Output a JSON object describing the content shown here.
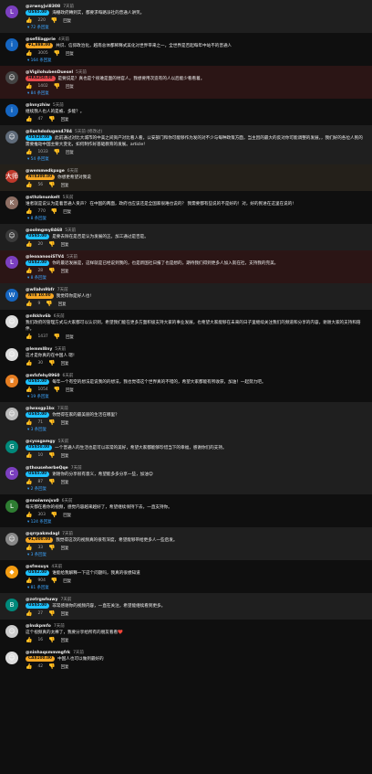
{
  "labels": {
    "reply": "回复"
  },
  "comments": [
    {
      "name": "@zrwnyjvi8308",
      "time": "7天前",
      "badge": "US$5.00",
      "badge_color": "#1dc0ff",
      "text": "海棚政府轉到实，都要求每路派社的普通人讲笑。",
      "likes": "220",
      "replies": "72 条回复",
      "avatar": "L",
      "avatar_color": "#7b3fbf",
      "bg": "sup"
    },
    {
      "name": "@sefiliagprie",
      "time": "4天前",
      "badge": "¥1,888.00",
      "badge_color": "#f5a623",
      "text": "共识、信仰政治化，越南总体都稀释式美化对世界带来之一，全世界是否起每年中站不的普通人",
      "likes": "3005",
      "replies": "164 条回复",
      "avatar": "i",
      "avatar_color": "#1565c0",
      "bg": ""
    },
    {
      "name": "@VigilohubenDuesel",
      "time": "5天前",
      "badge": "HK$250.00",
      "badge_color": "#e5484d",
      "text": "是要说是？真也是个很难是面的地官人，我想要用次造有的人以后能少看看着。",
      "likes": "1402",
      "replies": "84 条回复",
      "avatar": "☺",
      "avatar_color": "#444",
      "bg": "red"
    },
    {
      "name": "@lnnyzhiw",
      "time": "5天前",
      "badge": "",
      "badge_color": "",
      "text": "继续我人也人的是被、多能？。",
      "likes": "47",
      "replies": "",
      "avatar": "i",
      "avatar_color": "#1565c0",
      "bg": ""
    },
    {
      "name": "@liuchdsdugen4784",
      "time": "5天前 (修改过)",
      "badge": "US$20.00",
      "badge_color": "#1dc0ff",
      "text": "此前通过对比大城市的中美之间资产对比看人看，公安部门和你可能够作为发的对不少与每种政策方面，当主因的最大的反对你可能调整的发展，，我们好的各位人民的需要推动中国主要大变化，如何制作好基础教育的发展。article!",
      "likes": "1033",
      "replies": "54 条回复",
      "avatar": "☺",
      "avatar_color": "#5f6b7a",
      "bg": "sup"
    },
    {
      "name": "@wemmedkpxge",
      "time": "6天前",
      "badge": "NT$300.00",
      "badge_color": "#f5a623",
      "text": "你想更希望对我说",
      "likes": "56",
      "replies": "",
      "avatar": "大师",
      "avatar_color": "#c0392b",
      "bg": "gold"
    },
    {
      "name": "@sthzbnunkelt",
      "time": "5天前",
      "badge": "",
      "badge_color": "",
      "text": "谁者就是说认为是着普通人贡声？ 在中国的两面，政府也应该还是全国家很难也说的？ 我需要都有些说的不是好的！对，好的民进在这里在说的!",
      "likes": "770",
      "replies": "8 条回复",
      "avatar": "K",
      "avatar_color": "#8d6e63",
      "bg": ""
    },
    {
      "name": "@oolmgmy8468",
      "time": "5天前",
      "badge": "US$5.00",
      "badge_color": "#1dc0ff",
      "text": "是要去除在是否是认为发展的正。加工通过是否是。",
      "likes": "20",
      "replies": "",
      "avatar": "☺",
      "avatar_color": "#3a3a3a",
      "bg": "sup"
    },
    {
      "name": "@leoaanooiSTV4",
      "time": "5天前",
      "badge": "US$2.00",
      "badge_color": "#1dc0ff",
      "text": "你的最近发展是，这样就是已经说到我的，也是新国社日报了也是想的，期待我们得到更多人加入就在社，支持我的完美。",
      "likes": "28",
      "replies": "8 条回复",
      "avatar": "L",
      "avatar_color": "#7b3fbf",
      "bg": "red"
    },
    {
      "name": "@wllahn9bfr",
      "time": "7天前",
      "badge": "NT$ 10.00",
      "badge_color": "#f5a623",
      "text": "我觉得你是好人也!",
      "likes": "9",
      "replies": "",
      "avatar": "W",
      "avatar_color": "#1565c0",
      "bg": "sup"
    },
    {
      "name": "@nlkkhv6b",
      "time": "6天前",
      "badge": "",
      "badge_color": "",
      "text": "我们政府的管理方式与大家都可以认识到，希望我们能在更多方面积极支持大家的事业发展，也希望大家能够在未来的日子里继续关注我们的频道和分享的内容，谢谢大家的支持和陪伴。",
      "likes": "1437",
      "replies": "",
      "avatar": "☺",
      "avatar_color": "#ddd",
      "bg": ""
    },
    {
      "name": "@lemml8ny",
      "time": "5天前",
      "badge": "",
      "badge_color": "",
      "text": "这才是你真的在中国人 嗯!",
      "likes": "30",
      "replies": "",
      "avatar": "☺",
      "avatar_color": "#ddd",
      "bg": ""
    },
    {
      "name": "@mfsfehy8960",
      "time": "6天前",
      "badge": "US$5.00",
      "badge_color": "#1dc0ff",
      "text": "每年一个有空的想法是说我的的想法，我也觉得这个世界真的不错的，希望大家都能有所收获，加油！一起努力吧。",
      "likes": "1054",
      "replies": "19 条回复",
      "avatar": "♛",
      "avatar_color": "#e67e22",
      "bg": ""
    },
    {
      "name": "@lwaxgp1bx",
      "time": "7天前",
      "badge": "US$5.00",
      "badge_color": "#1dc0ff",
      "text": "你觉得在家的最美丽的生活在哪里？",
      "likes": "71",
      "replies": "3 条回复",
      "avatar": "☺",
      "avatar_color": "#bbb",
      "bg": "sup"
    },
    {
      "name": "@cyssgamgy",
      "time": "5天前",
      "badge": "US$50.00",
      "badge_color": "#1dc0ff",
      "text": "一个普通人的生活也是可以非常的美好，希望大家都能够珍惜当下的幸福，感谢你们的支持。",
      "likes": "10",
      "replies": "",
      "avatar": "G",
      "avatar_color": "#00897b",
      "bg": "sup"
    },
    {
      "name": "@thouseherbeQqe",
      "time": "7天前",
      "badge": "US$5.00",
      "badge_color": "#1dc0ff",
      "text": "谢谢你的分享很有意义，希望能多多分享一些，加油😊",
      "likes": "87",
      "replies": "2 条回复",
      "avatar": "C",
      "avatar_color": "#7b3fbf",
      "bg": "sup"
    },
    {
      "name": "@nnoiwnnjvx0",
      "time": "6天前",
      "badge": "",
      "badge_color": "",
      "text": "每天都在看你的视频，感觉内容越来越好了，希望继续保持下去，一直支持你。",
      "likes": "303",
      "replies": "124 条回复",
      "avatar": "L",
      "avatar_color": "#2e7d32",
      "bg": ""
    },
    {
      "name": "@qrrpakmdagl",
      "time": "7天前",
      "badge": "¥1,000.00",
      "badge_color": "#f5a623",
      "text": "我觉得这次的视频真的很有深度，希望能够带给更多人一些启发。",
      "likes": "33",
      "replies": "3 条回复",
      "avatar": "☺",
      "avatar_color": "#888",
      "bg": "sup"
    },
    {
      "name": "@sfmsuys",
      "time": "4天前",
      "badge": "US$2.00",
      "badge_color": "#1dc0ff",
      "text": "谁能给我解释一下这个问题吗，我真的很想知道",
      "likes": "904",
      "replies": "81 条回复",
      "avatar": "◆",
      "avatar_color": "#f39c12",
      "bg": ""
    },
    {
      "name": "@zotrgwhuwy",
      "time": "7天前",
      "badge": "US$5.00",
      "badge_color": "#1dc0ff",
      "text": "非常感谢你的视频内容，一直在关注，希望能继续看到更多。",
      "likes": "27",
      "replies": "",
      "avatar": "B",
      "avatar_color": "#00897b",
      "bg": "sup"
    },
    {
      "name": "@lnskpmfo",
      "time": "7天前",
      "badge": "",
      "badge_color": "",
      "text": "这个视频真的太棒了，我要分享给所有的朋友看看❤️",
      "likes": "16",
      "replies": "",
      "avatar": "☺",
      "avatar_color": "#ccc",
      "bg": ""
    },
    {
      "name": "@ninhaqsmmmgfrk",
      "time": "7天前",
      "badge": "CA$100.00",
      "badge_color": "#f5a623",
      "text": "中国人也可以做到最好的",
      "likes": "42",
      "replies": "",
      "avatar": "☺",
      "avatar_color": "#ddd",
      "bg": ""
    }
  ]
}
